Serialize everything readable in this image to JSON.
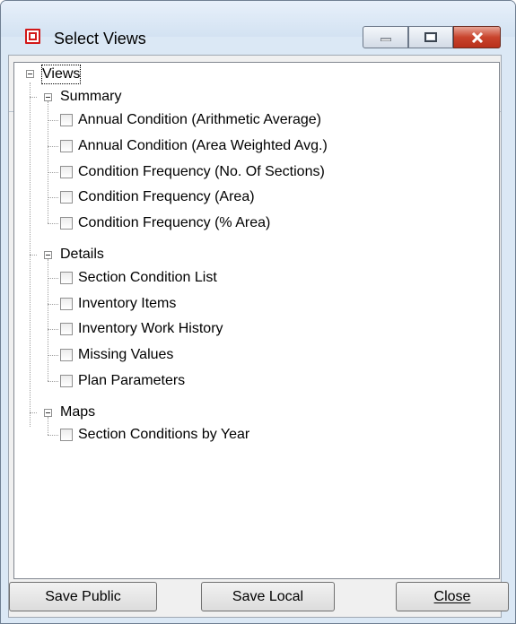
{
  "window": {
    "title": "Select Views"
  },
  "tree": {
    "root": "Views",
    "groups": [
      {
        "label": "Summary",
        "items": [
          "Annual Condition (Arithmetic Average)",
          "Annual Condition (Area Weighted Avg.)",
          "Condition Frequency (No. Of Sections)",
          "Condition Frequency (Area)",
          "Condition Frequency (% Area)"
        ]
      },
      {
        "label": "Details",
        "items": [
          "Section Condition List",
          "Inventory Items",
          "Inventory Work History",
          "Missing Values",
          "Plan Parameters"
        ]
      },
      {
        "label": "Maps",
        "items": [
          "Section Conditions by Year"
        ]
      }
    ]
  },
  "buttons": {
    "save_public": "Save Public",
    "save_local": "Save Local",
    "close": "Close"
  },
  "colors": {
    "close_caption": "#c9442d",
    "window_frame": "#dbe8f5"
  }
}
